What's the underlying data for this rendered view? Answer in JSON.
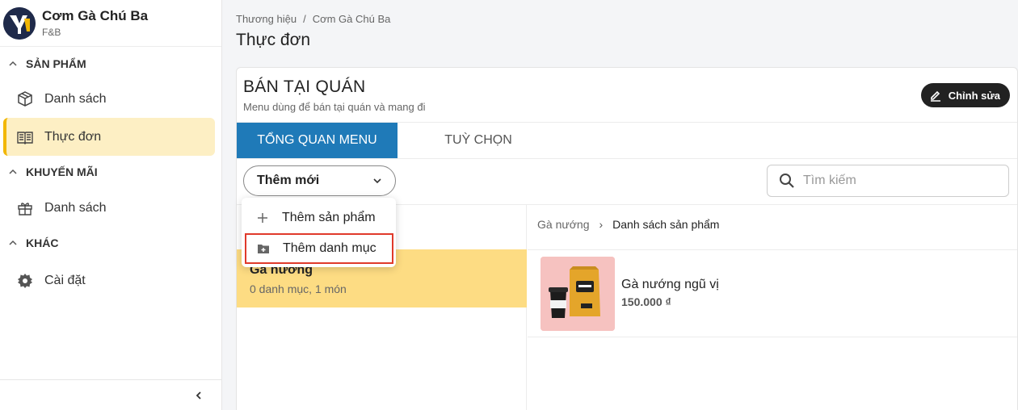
{
  "brand": {
    "name": "Cơm Gà Chú Ba",
    "subtitle": "F&B",
    "logo": "brand-logo"
  },
  "sidebar": {
    "sections": [
      {
        "title": "SẢN PHẨM",
        "items": [
          {
            "label": "Danh sách",
            "icon": "box-icon",
            "active": false
          },
          {
            "label": "Thực đơn",
            "icon": "menu-book-icon",
            "active": true
          }
        ]
      },
      {
        "title": "KHUYẾN MÃI",
        "items": [
          {
            "label": "Danh sách",
            "icon": "gift-icon",
            "active": false
          }
        ]
      },
      {
        "title": "KHÁC",
        "items": [
          {
            "label": "Cài đặt",
            "icon": "gear-icon",
            "active": false
          }
        ]
      }
    ],
    "collapse_icon": "chevron-left-icon"
  },
  "header": {
    "breadcrumb": [
      "Thương hiệu",
      "Cơm Gà Chú Ba"
    ],
    "title": "Thực đơn"
  },
  "menu_card": {
    "title": "BÁN TẠI QUÁN",
    "subtitle": "Menu dùng để bán tại quán và mang đi",
    "edit_label": "Chỉnh sửa",
    "tabs": [
      {
        "label": "TỔNG QUAN MENU",
        "active": true
      },
      {
        "label": "TUỲ CHỌN",
        "active": false
      }
    ],
    "add_select_label": "Thêm mới",
    "search_placeholder": "Tìm kiếm",
    "dropdown": [
      {
        "label": "Thêm sản phẩm",
        "icon": "plus-icon"
      },
      {
        "label": "Thêm danh mục",
        "icon": "folder-plus-icon",
        "highlighted": true
      }
    ],
    "categories": [
      {
        "name": "Gà nướng",
        "meta": "0 danh mục, 1 món",
        "selected": true
      }
    ],
    "right_breadcrumb": [
      "Gà nướng",
      "Danh sách sản phẩm"
    ],
    "products": [
      {
        "name": "Gà nướng ngũ vị",
        "price": "150.000 ₫"
      }
    ]
  },
  "colors": {
    "accent": "#1f7ab8",
    "active_bg": "#fdefc4",
    "active_bar": "#f2b705",
    "category_bg": "#fddc83",
    "highlight_border": "#e03a2b"
  }
}
